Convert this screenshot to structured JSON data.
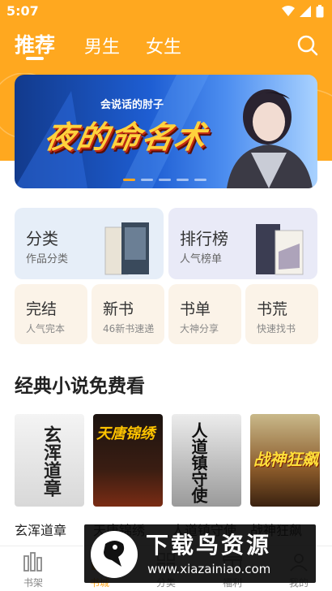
{
  "status_bar": {
    "time": "5:07"
  },
  "top_tabs": [
    {
      "label": "推荐",
      "active": true
    },
    {
      "label": "男生",
      "active": false
    },
    {
      "label": "女生",
      "active": false
    }
  ],
  "banner": {
    "author": "会说话的肘子",
    "title": "夜的命名术",
    "slide_count": 5,
    "active_slide": 1
  },
  "categories": {
    "big": [
      {
        "title": "分类",
        "sub": "作品分类"
      },
      {
        "title": "排行榜",
        "sub": "人气榜单"
      }
    ],
    "small": [
      {
        "title": "完结",
        "sub": "人气完本"
      },
      {
        "title": "新书",
        "sub": "46新书速递"
      },
      {
        "title": "书单",
        "sub": "大神分享"
      },
      {
        "title": "书荒",
        "sub": "快速找书"
      }
    ]
  },
  "section": {
    "title": "经典小说免费看",
    "books": [
      {
        "name": "玄浑道章",
        "cover_text": "玄浑道章"
      },
      {
        "name": "天唐锦绣",
        "cover_text": "天唐锦绣"
      },
      {
        "name": "人道镇守使",
        "cover_text": "人道镇守使"
      },
      {
        "name": "战神狂飙",
        "cover_text": "战神狂飙"
      }
    ]
  },
  "bottom_nav": [
    {
      "label": "书架",
      "icon": "bookshelf-icon",
      "active": false
    },
    {
      "label": "书城",
      "icon": "store-icon",
      "active": true
    },
    {
      "label": "分类",
      "icon": "category-icon",
      "active": false
    },
    {
      "label": "福利",
      "icon": "gift-icon",
      "active": false
    },
    {
      "label": "我的",
      "icon": "user-icon",
      "active": false
    }
  ],
  "watermark": {
    "title": "下载鸟资源",
    "url": "www.xiazainiao.com"
  },
  "colors": {
    "accent": "#ffa81f",
    "card_blue": "#e6eef8",
    "card_purple": "#e9eaf7",
    "card_cream": "#fbf3e8"
  }
}
